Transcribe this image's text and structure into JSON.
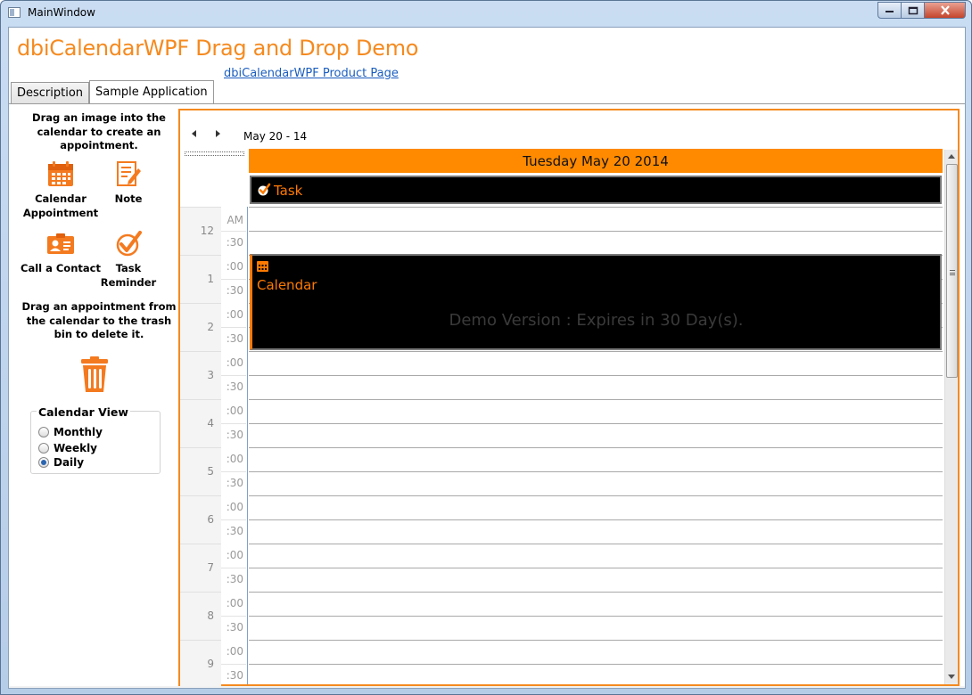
{
  "window": {
    "title": "MainWindow"
  },
  "app": {
    "title": "dbiCalendarWPF Drag and Drop Demo",
    "product_link": "dbiCalendarWPF Product Page"
  },
  "tabs": [
    {
      "label": "Description"
    },
    {
      "label": "Sample Application"
    }
  ],
  "sidebar": {
    "drag_instruction": "Drag an image into the calendar to create an appointment.",
    "tools": [
      {
        "label": "Calendar Appointment",
        "icon": "calendar-icon"
      },
      {
        "label": "Note",
        "icon": "note-icon"
      },
      {
        "label": "Call a Contact",
        "icon": "contact-card-icon"
      },
      {
        "label": "Task Reminder",
        "icon": "checkmark-icon"
      }
    ],
    "delete_instruction": "Drag an appointment from the calendar to the trash bin to delete it.",
    "view_group": {
      "legend": "Calendar View",
      "options": [
        {
          "label": "Monthly",
          "selected": false
        },
        {
          "label": "Weekly",
          "selected": false
        },
        {
          "label": "Daily",
          "selected": true
        }
      ]
    }
  },
  "calendar": {
    "date_range": "May 20 - 14",
    "day_header": "Tuesday May 20 2014",
    "allday_task": "Task",
    "appointment_label": "Calendar",
    "demo_notice": "Demo Version : Expires in 30 Day(s).",
    "am_label": "AM",
    "hours": [
      "12",
      "1",
      "2",
      "3",
      "4",
      "5",
      "6",
      "7",
      "8",
      "9"
    ],
    "min_00": ":00",
    "min_30": ":30",
    "accent_color": "#ff8a00"
  }
}
